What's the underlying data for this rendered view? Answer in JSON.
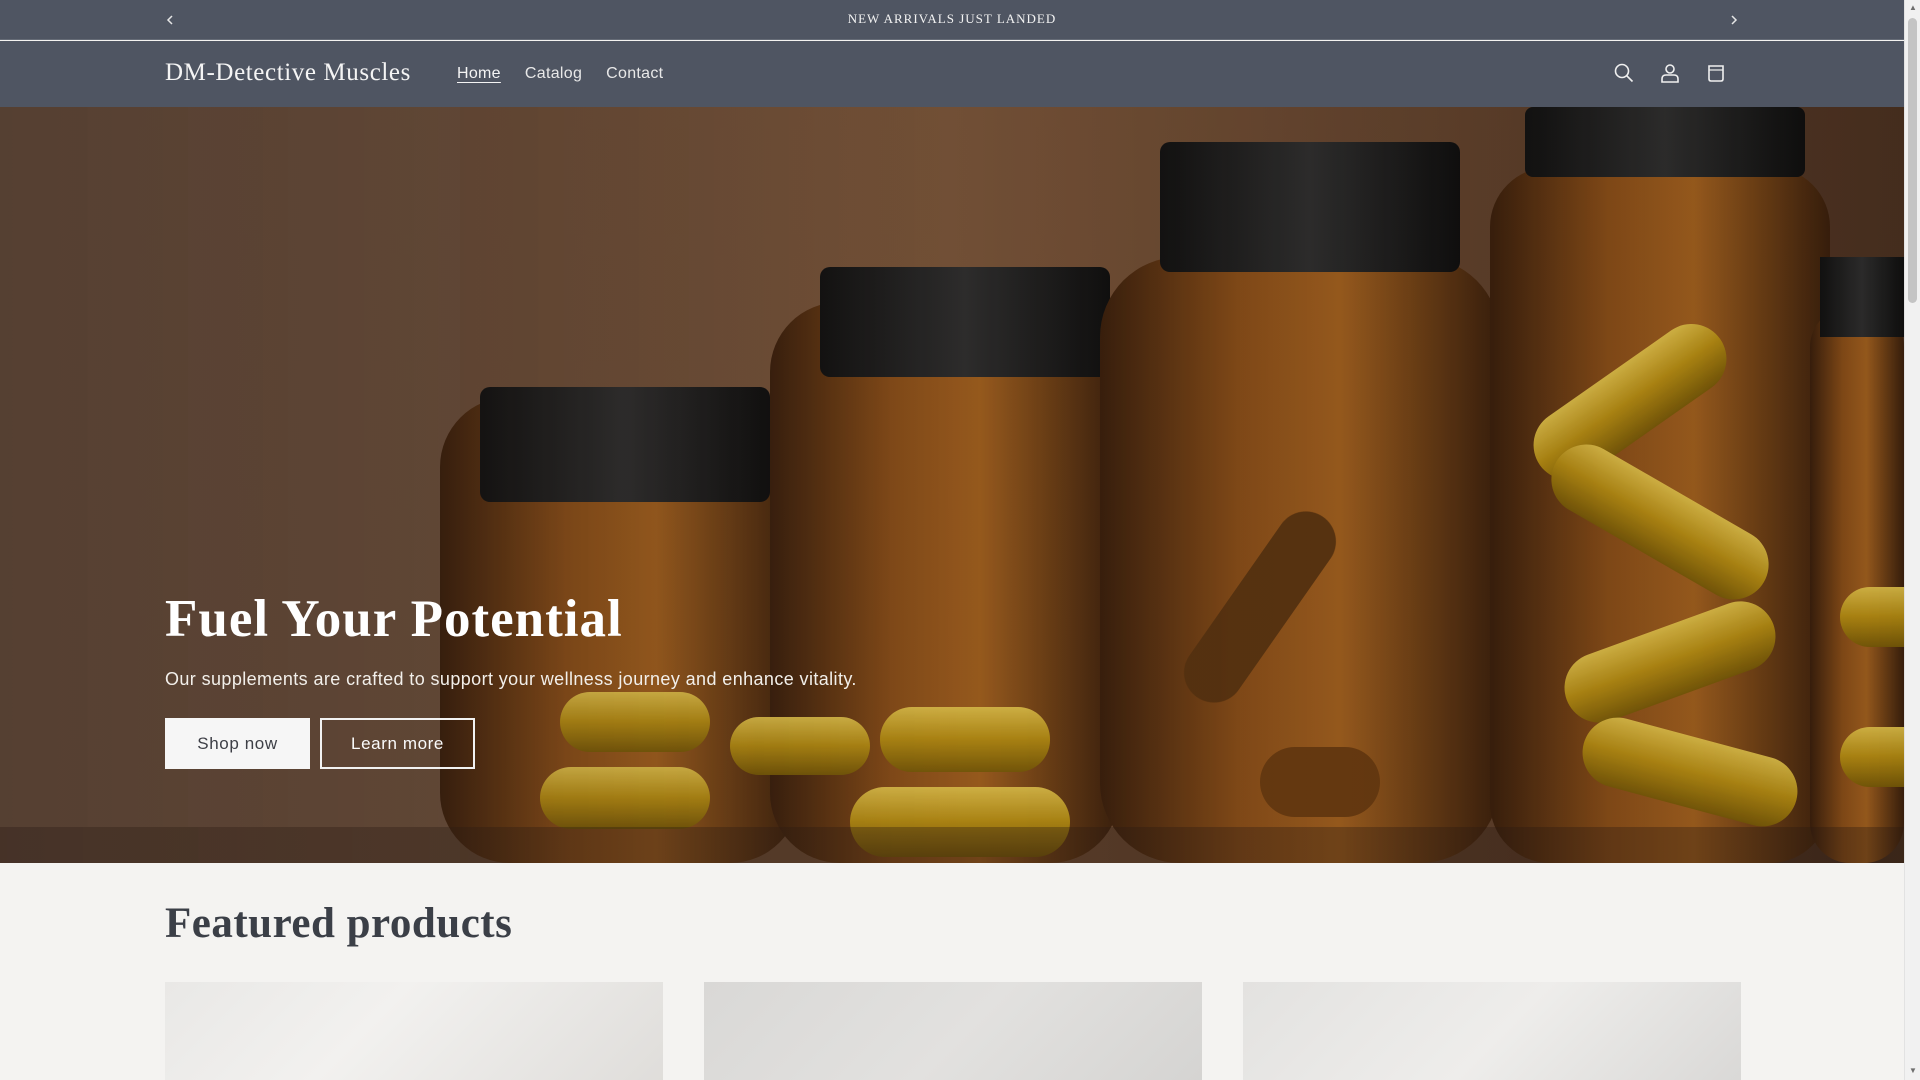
{
  "announcement": {
    "text": "NEW ARRIVALS JUST LANDED",
    "prev_icon": "chevron-left-icon",
    "next_icon": "chevron-right-icon"
  },
  "header": {
    "logo": "DM-Detective Muscles",
    "nav": [
      {
        "label": "Home",
        "active": true
      },
      {
        "label": "Catalog",
        "active": false
      },
      {
        "label": "Contact",
        "active": false
      }
    ],
    "icons": [
      "search-icon",
      "account-icon",
      "cart-icon"
    ]
  },
  "hero": {
    "title": "Fuel Your Potential",
    "subtitle": "Our supplements are crafted to support your wellness journey and enhance vitality.",
    "primary_button": "Shop now",
    "secondary_button": "Learn more"
  },
  "featured": {
    "title": "Featured products"
  },
  "colors": {
    "header_bg": "#4f5562",
    "page_bg": "#f4f3f1",
    "text_dark": "#3b3f47"
  }
}
